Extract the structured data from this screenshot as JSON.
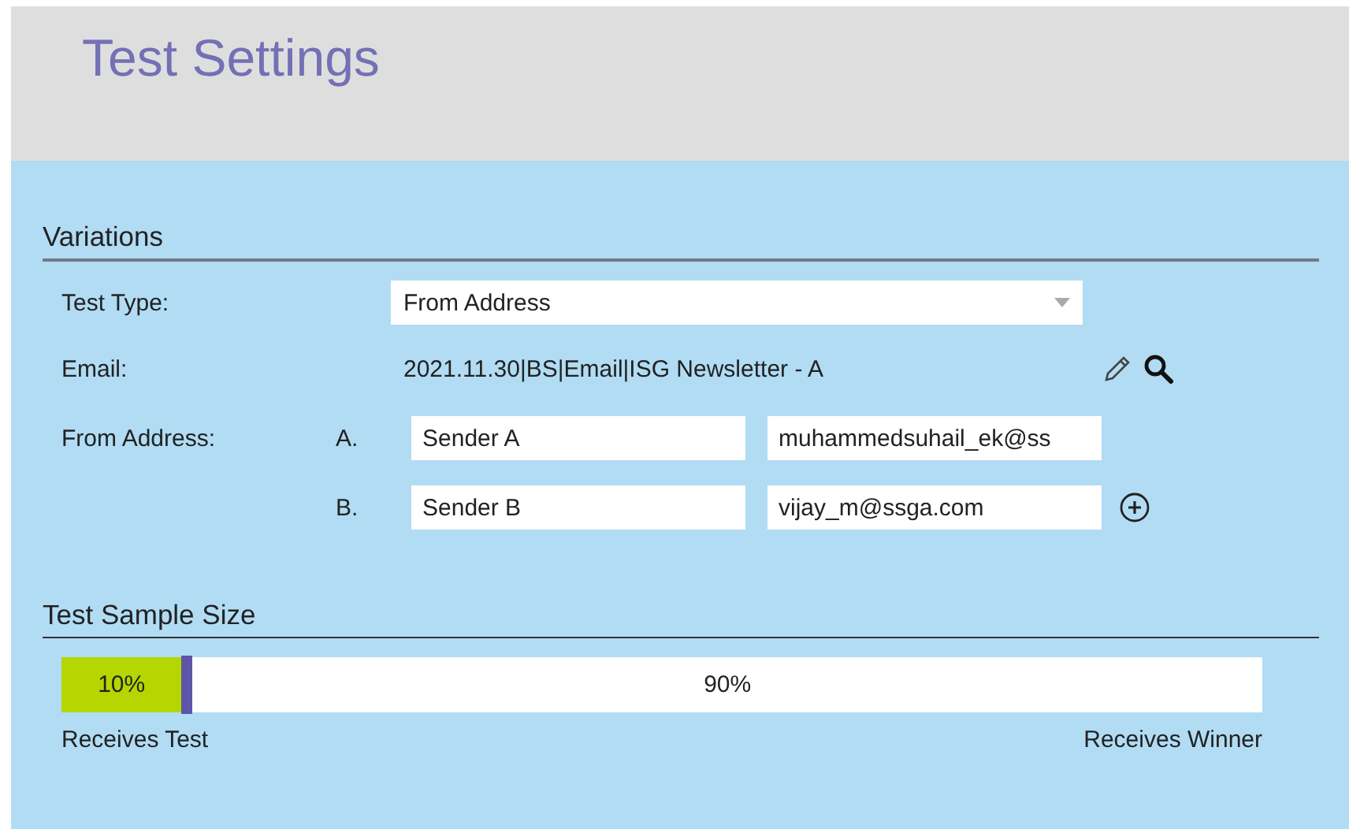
{
  "header": {
    "title": "Test Settings"
  },
  "variations": {
    "heading": "Variations",
    "test_type": {
      "label": "Test Type:",
      "value": "From Address"
    },
    "email": {
      "label": "Email:",
      "value": "2021.11.30|BS|Email|ISG Newsletter - A"
    },
    "from_address": {
      "label": "From Address:",
      "senders": [
        {
          "letter": "A.",
          "name": "Sender A",
          "address": "muhammedsuhail_ek@ss",
          "add_button": false
        },
        {
          "letter": "B.",
          "name": "Sender B",
          "address": "vijay_m@ssga.com",
          "add_button": true
        }
      ]
    }
  },
  "sample_size": {
    "heading": "Test Sample Size",
    "level": 0.1,
    "test_reading": "10%",
    "winner_reading": "90%",
    "test_label": "Receives Test",
    "winner_label": "Receives Winner"
  }
}
